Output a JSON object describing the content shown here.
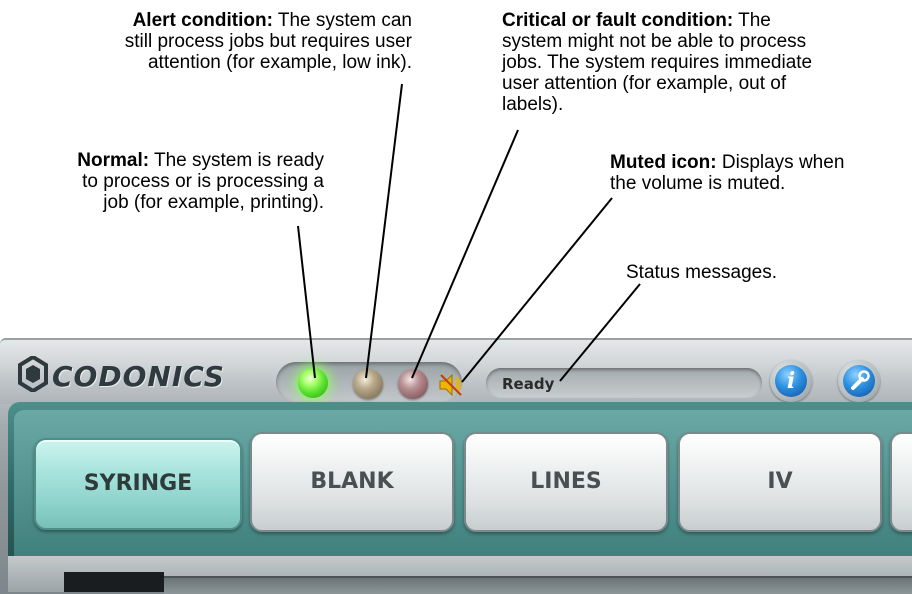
{
  "callouts": {
    "alert": {
      "label": "Alert condition:",
      "line1": " The system can",
      "line2": "still process jobs but requires user",
      "line3": "attention (for example, low ink)."
    },
    "critical": {
      "label": "Critical or fault condition:",
      "line1": " The",
      "line2": "system might not be able to process",
      "line3": "jobs. The system requires immediate",
      "line4": "user attention (for example, out of",
      "line5": "labels)."
    },
    "normal": {
      "label": "Normal:",
      "line1": " The system is ready",
      "line2": "to process or is processing a",
      "line3": "job (for example, printing)."
    },
    "muted": {
      "label": "Muted icon:",
      "line1": " Displays when",
      "line2": "the volume is muted."
    },
    "status": {
      "text": "Status messages."
    }
  },
  "app": {
    "logo_text": "CODONICS",
    "status_message": "Ready",
    "info_glyph": "i",
    "icons": [
      "codonics-logo-icon",
      "normal-status-light-icon",
      "alert-status-light-icon",
      "fault-status-light-icon",
      "muted-speaker-icon",
      "info-icon",
      "tools-icon"
    ]
  },
  "tabs": [
    {
      "label": "SYRINGE",
      "active": true
    },
    {
      "label": "BLANK",
      "active": false
    },
    {
      "label": "LINES",
      "active": false
    },
    {
      "label": "IV",
      "active": false
    },
    {
      "label": "",
      "active": false
    }
  ],
  "colors": {
    "normal_light": "#55e02a",
    "alert_light": "#8a7b5f",
    "fault_light": "#8a5f63",
    "active_tab": "#a9e5de",
    "tab_bar": "#2f6e6b",
    "muted_icon": "#f0b400"
  }
}
